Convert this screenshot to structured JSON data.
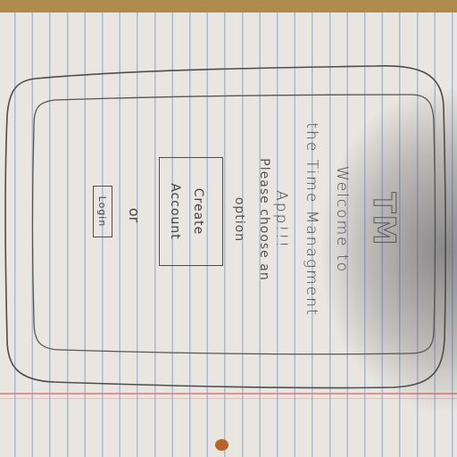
{
  "app": {
    "logo": "TM",
    "welcome_line1": "Welcome to",
    "welcome_line2": "the Time Managment",
    "welcome_line3": "App!!!"
  },
  "prompt": {
    "line1": "Please choose an",
    "line2": "option"
  },
  "actions": {
    "create_line1": "Create",
    "create_line2": "Account",
    "or_label": "or",
    "login_label": "Login"
  },
  "colors": {
    "paper": "#e9e6e1",
    "rule_lines": "#7896c8",
    "margin_line": "#d77878",
    "pencil": "#4a4a4a"
  }
}
